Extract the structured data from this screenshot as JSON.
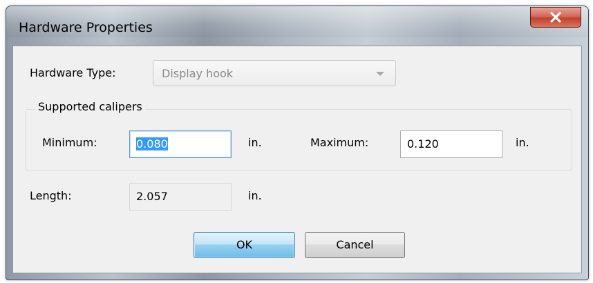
{
  "window": {
    "title": "Hardware Properties"
  },
  "hardware_type": {
    "label": "Hardware Type:",
    "value": "Display hook"
  },
  "calipers": {
    "group_label": "Supported calipers",
    "minimum_label": "Minimum:",
    "minimum_value": "0.080",
    "minimum_unit": "in.",
    "maximum_label": "Maximum:",
    "maximum_value": "0.120",
    "maximum_unit": "in."
  },
  "length": {
    "label": "Length:",
    "value": "2.057",
    "unit": "in."
  },
  "buttons": {
    "ok": "OK",
    "cancel": "Cancel"
  },
  "icons": {
    "close": "close-icon",
    "dropdown": "chevron-down-icon"
  },
  "colors": {
    "close_button": "#c94c3a",
    "selection": "#3399ff",
    "default_button": "#98d1ef"
  }
}
